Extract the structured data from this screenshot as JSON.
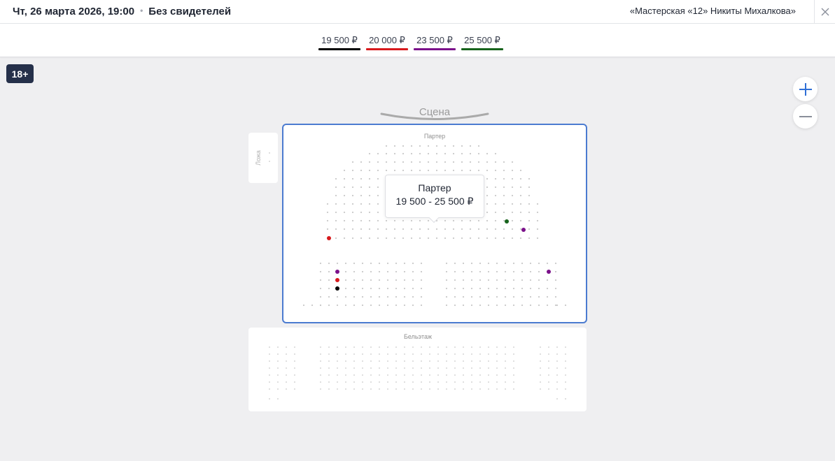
{
  "header": {
    "date": "Чт, 26 марта 2026, 19:00",
    "separator": "•",
    "show_title": "Без свидетелей",
    "venue": "«Мастерская «12» Никиты Михалкова»",
    "close_icon": "close-icon"
  },
  "price_legend": [
    {
      "label": "19 500 ₽",
      "color": "#000000"
    },
    {
      "label": "20 000 ₽",
      "color": "#d7191c"
    },
    {
      "label": "23 500 ₽",
      "color": "#7b118a"
    },
    {
      "label": "25 500 ₽",
      "color": "#17631c"
    }
  ],
  "age_rating": "18+",
  "zoom": {
    "in_icon": "plus-icon",
    "out_icon": "minus-icon"
  },
  "hall": {
    "stage_label": "Сцена",
    "box_label": "Ложа",
    "parterre_label": "Партер",
    "balcony_label": "Бельэтаж"
  },
  "tooltip": {
    "title": "Партер",
    "price_range": "19 500 - 25 500 ₽"
  }
}
